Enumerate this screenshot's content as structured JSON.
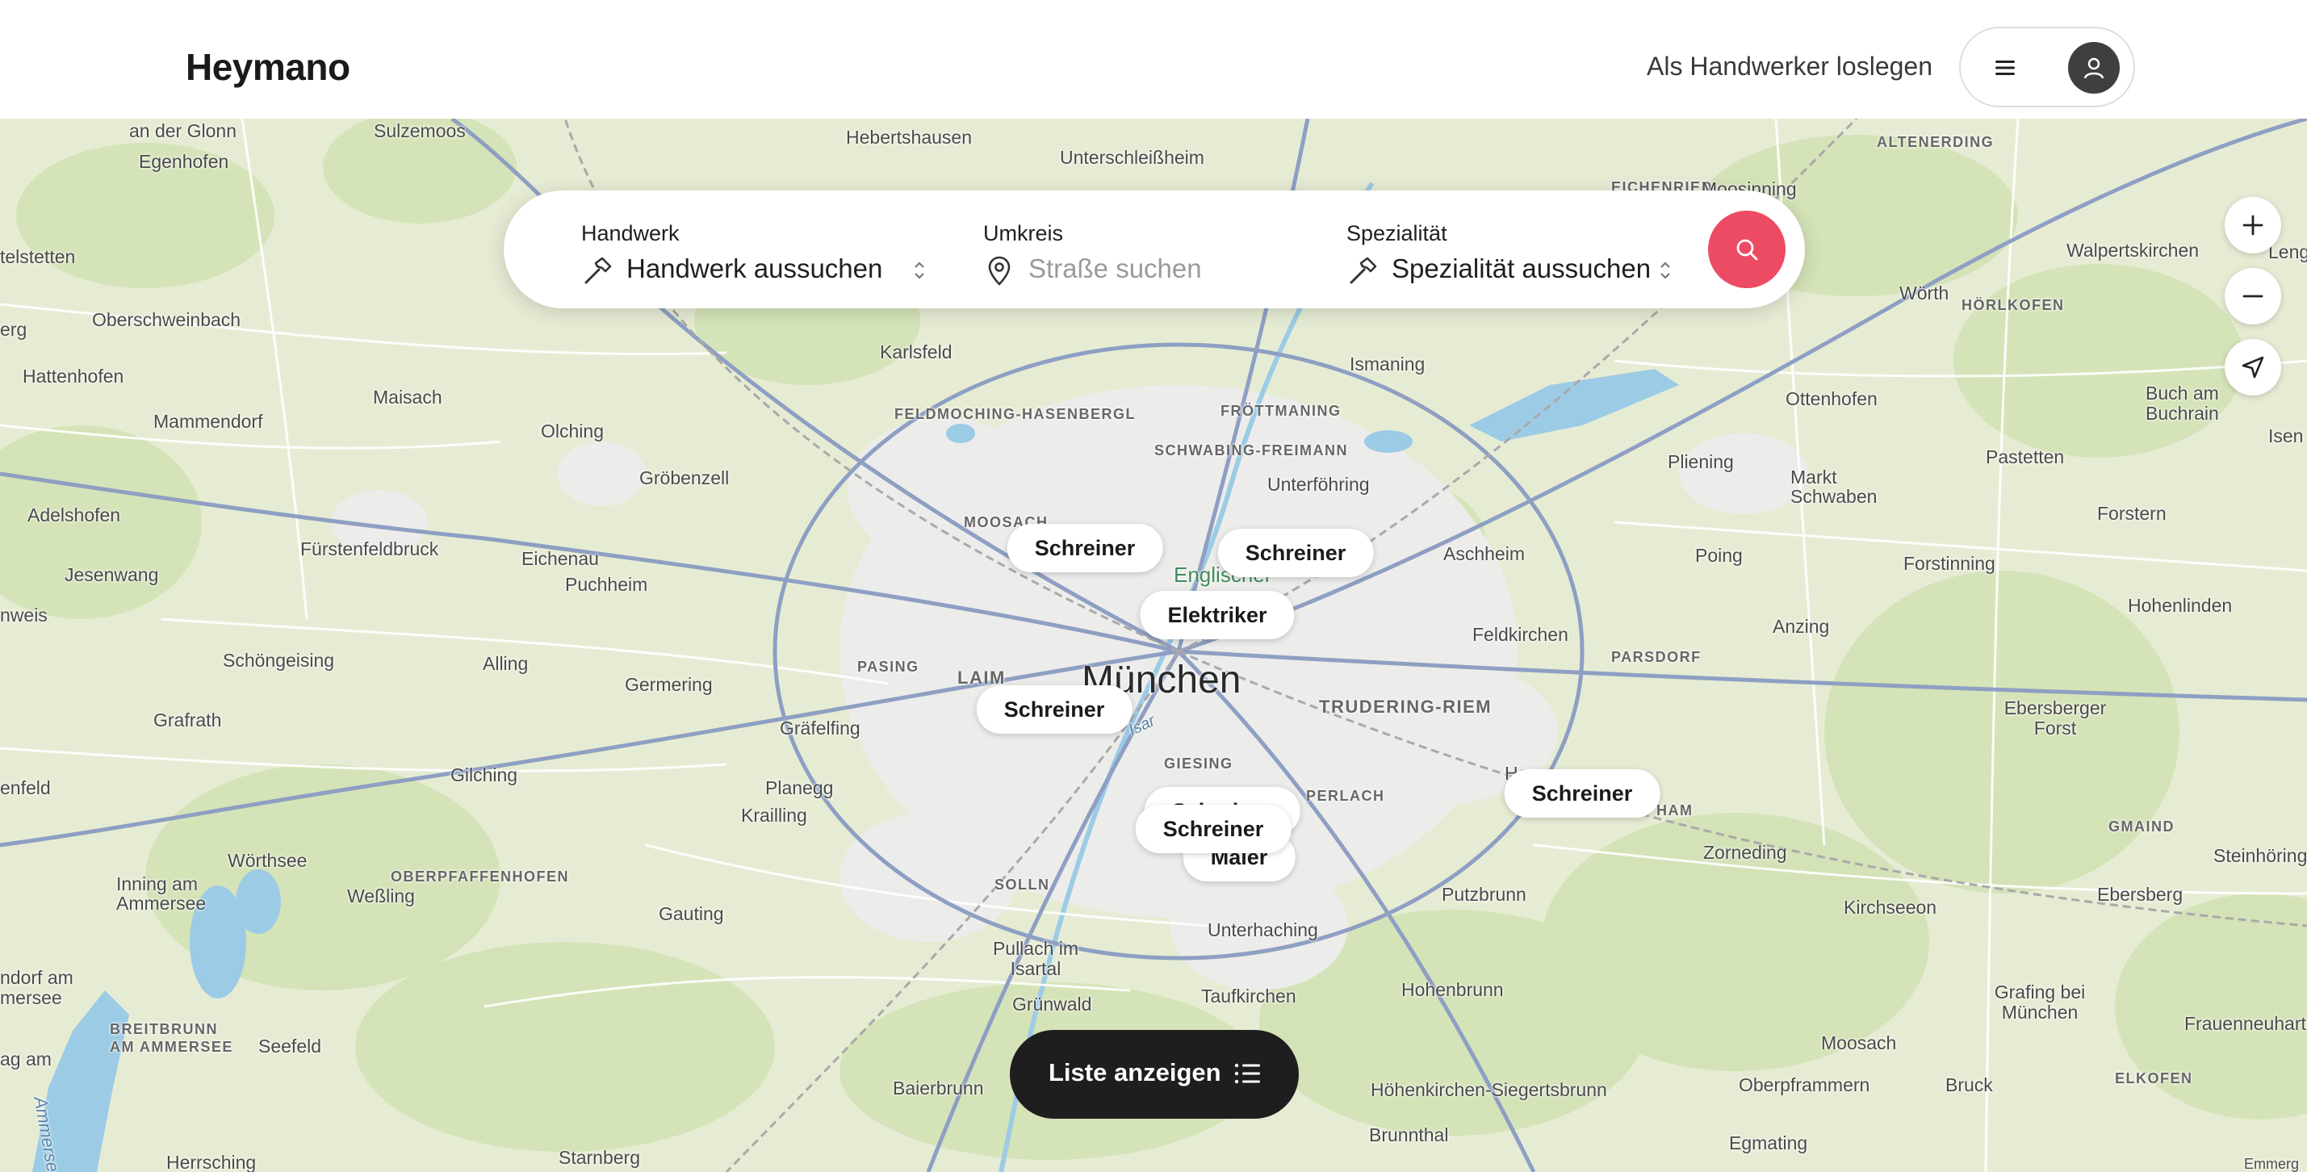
{
  "header": {
    "logo": "Heymano",
    "host_link": "Als Handwerker loslegen",
    "menu_icon": "hamburger-menu-icon",
    "avatar_icon": "user-icon"
  },
  "search": {
    "trade": {
      "label": "Handwerk",
      "value": "Handwerk aussuchen",
      "icon": "hammer-icon"
    },
    "radius": {
      "label": "Umkreis",
      "placeholder": "Straße suchen",
      "icon": "location-pin-icon"
    },
    "specialty": {
      "label": "Spezialität",
      "value": "Spezialität aussuchen",
      "icon": "hammer-icon"
    },
    "submit_icon": "search-icon",
    "accent_color": "#ec4b63"
  },
  "map_controls": {
    "zoom_in": "plus-icon",
    "zoom_out": "minus-icon",
    "locate": "navigation-arrow-icon"
  },
  "markers": [
    "Schreiner",
    "Schreiner",
    "Elektriker",
    "Schreiner",
    "Schreiner",
    "Schreiner",
    "Maler",
    "Schreiner"
  ],
  "places": {
    "muenchen": "München",
    "an_der_glonn": "an der Glonn",
    "egenhofen": "Egenhofen",
    "sulzemoos": "Sulzemoos",
    "hebertshausen": "Hebertshausen",
    "unterschleissheim": "Unterschleißheim",
    "altenerding": "ALTENERDING",
    "eichenried": "EICHENRIED",
    "moosinning": "Moosinning",
    "telstetten": "telstetten",
    "oberschweinbach": "Oberschweinbach",
    "karlsfeld": "Karlsfeld",
    "ismaning": "Ismaning",
    "woerth": "Wörth",
    "hoerlkofen": "HÖRLKOFEN",
    "walpertskirchen": "Walpertskirchen",
    "lengdorf": "Lengdorf",
    "erg": "erg",
    "hattenhofen": "Hattenhofen",
    "maisach": "Maisach",
    "feldmoching": "FELDMOCHING-HASENBERGL",
    "froettmaning": "FRÖTTMANING",
    "ottenhofen": "Ottenhofen",
    "buch_am_buchrain": "Buch am Buchrain",
    "isen": "Isen",
    "mammendorf": "Mammendorf",
    "olching": "Olching",
    "schwabing": "SCHWABING-FREIMANN",
    "groebenzell": "Gröbenzell",
    "unterfoehring": "Unterföhring",
    "pliening": "Pliening",
    "markt_schwaben": "Markt Schwaben",
    "pastetten": "Pastetten",
    "adelshofen": "Adelshofen",
    "moosach": "MOOSACH",
    "forstern": "Forstern",
    "fuerstenfeldbruck": "Fürstenfeldbruck",
    "eichenau": "Eichenau",
    "aschheim": "Aschheim",
    "poing": "Poing",
    "forstinning": "Forstinning",
    "jesenwang": "Jesenwang",
    "puchheim": "Puchheim",
    "englischer": "Englischer",
    "hohenlinden": "Hohenlinden",
    "nweis": "nweis",
    "anzing": "Anzing",
    "feldkirchen": "Feldkirchen",
    "parsdorf": "PARSDORF",
    "schoengeising": "Schöngeising",
    "alling": "Alling",
    "pasing": "PASING",
    "laim": "LAIM",
    "germering": "Germering",
    "trudering": "TRUDERING-RIEM",
    "grafrath": "Grafrath",
    "graefelfing": "Gräfelfing",
    "isar": "Isar",
    "ebersberger_forst": "Ebersberger Forst",
    "giesing": "GIESING",
    "gilching": "Gilching",
    "planegg": "Planegg",
    "perlach": "PERLACH",
    "haar": "Haar",
    "harham": "HAM",
    "enfeld": "enfeld",
    "krailling": "Krailling",
    "gmaind": "GMAIND",
    "woerthsee": "Wörthsee",
    "zorneding": "Zorneding",
    "steinhoering": "Steinhöring",
    "inning": "Inning am Ammersee",
    "oberpfaffenhofen": "OBERPFAFFENHOFEN",
    "solln": "SOLLN",
    "putzbrunn": "Putzbrunn",
    "ebersberg": "Ebersberg",
    "wessling": "Weßling",
    "kirchseeon": "Kirchseeon",
    "gauting": "Gauting",
    "unterhaching": "Unterhaching",
    "pullach": "Pullach im Isartal",
    "dorf_am_ammersee": "ndorf am mersee",
    "grafing": "Grafing bei München",
    "hohenbrunn": "Hohenbrunn",
    "frauenneuharting": "Frauenneuhartin",
    "taufkirchen": "Taufkirchen",
    "gruenwald": "Grünwald",
    "breitbrunn": "BREITBRUNN AM AMMERSEE",
    "seefeld": "Seefeld",
    "moosach2": "Moosach",
    "ag_am": "ag am",
    "oberpframmern": "Oberpframmern",
    "bruck": "Bruck",
    "elkofen": "ELKOFEN",
    "ammersee": "Ammerse",
    "baierbrunn": "Baierbrunn",
    "hoehenkirchen": "Höhenkirchen-Siegertsbrunn",
    "brunnthal": "Brunnthal",
    "egmating": "Egmating",
    "herrsching": "Herrsching",
    "starnberg": "Starnberg",
    "emmerg": "Emmerg"
  },
  "list_button": {
    "label": "Liste anzeigen",
    "icon": "list-icon"
  }
}
